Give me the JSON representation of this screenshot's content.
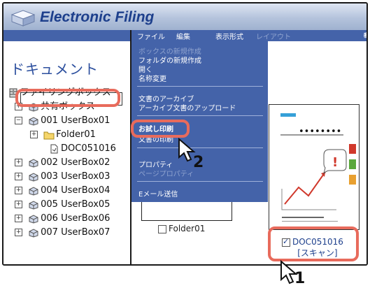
{
  "window": {
    "title": "Electronic Filing",
    "logo_icon": "folder-logo-icon"
  },
  "left_panel": {
    "heading": "ドキュメント",
    "tree": [
      {
        "label": "ファイリングボックス",
        "icon": "filing-cabinet-icon",
        "expander": ""
      },
      {
        "label": "共有ボックス",
        "icon": "user-box-icon",
        "expander": "+"
      },
      {
        "label": "001 UserBox01",
        "icon": "user-box-icon",
        "expander": "−",
        "selected": true
      },
      {
        "label": "Folder01",
        "icon": "folder-icon",
        "expander": "+"
      },
      {
        "label": "DOC051016",
        "icon": "document-icon",
        "expander": ""
      },
      {
        "label": "002 UserBox02",
        "icon": "user-box-icon",
        "expander": "+"
      },
      {
        "label": "003 UserBox03",
        "icon": "user-box-icon",
        "expander": "+"
      },
      {
        "label": "004 UserBox04",
        "icon": "user-box-icon",
        "expander": "+"
      },
      {
        "label": "005 UserBox05",
        "icon": "user-box-icon",
        "expander": "+"
      },
      {
        "label": "006 UserBox06",
        "icon": "user-box-icon",
        "expander": "+"
      },
      {
        "label": "007 UserBox07",
        "icon": "user-box-icon",
        "expander": "+"
      }
    ]
  },
  "menubar": {
    "file": "ファイル",
    "edit": "編集",
    "view": "表示形式",
    "layout": "レイアウト"
  },
  "dropdown": {
    "items": [
      {
        "label": "ボックスの新規作成",
        "enabled": false
      },
      {
        "label": "フォルダの新規作成",
        "enabled": true
      },
      {
        "label": "開く",
        "enabled": true
      },
      {
        "label": "名称変更",
        "enabled": true
      },
      {
        "label": "文書のアーカイブ",
        "enabled": true
      },
      {
        "label": "アーカイブ文書のアップロード",
        "enabled": true
      },
      {
        "label": "お試し印刷",
        "enabled": true,
        "highlighted": true
      },
      {
        "label": "文書の印刷",
        "enabled": true
      },
      {
        "label": "プロパティ",
        "enabled": true
      },
      {
        "label": "ページプロパティ",
        "enabled": false
      },
      {
        "label": "Eメール送信",
        "enabled": true
      }
    ]
  },
  "content": {
    "folder_item": "Folder01",
    "doc_name": "DOC051016",
    "doc_type": "[スキャン]",
    "thumb_dots": "••••••••"
  },
  "callouts": {
    "step1": "1",
    "step2": "2"
  },
  "colors": {
    "menu_bg": "#4463a9",
    "highlight": "#e86b5c",
    "accent_red": "#d0382b",
    "accent_green": "#5aa83c",
    "accent_orange": "#e8a030"
  }
}
